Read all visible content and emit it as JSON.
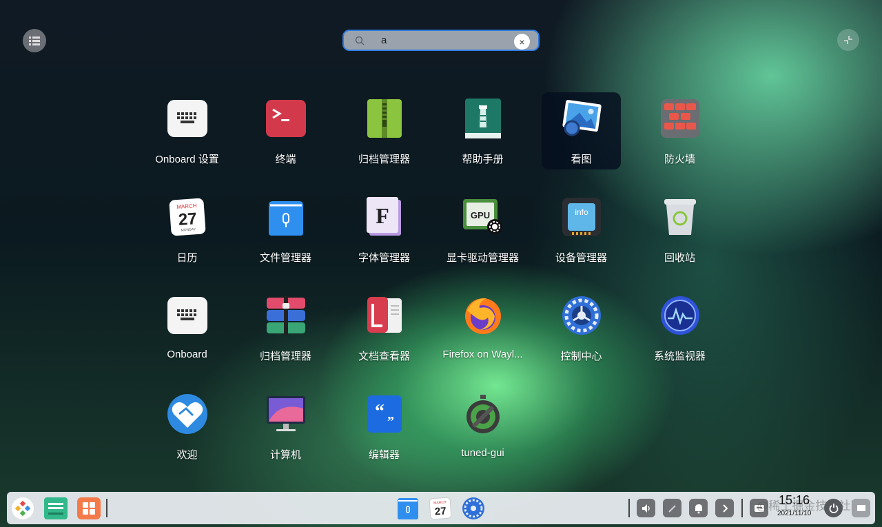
{
  "search": {
    "value": "a",
    "clear_symbol": "×",
    "icon": "search-icon"
  },
  "apps": [
    {
      "label": "Onboard 设置",
      "icon": "keyboard-icon"
    },
    {
      "label": "终端",
      "icon": "terminal-icon"
    },
    {
      "label": "归档管理器",
      "icon": "archive-zip-icon"
    },
    {
      "label": "帮助手册",
      "icon": "help-manual-icon"
    },
    {
      "label": "看图",
      "icon": "image-viewer-icon"
    },
    {
      "label": "防火墙",
      "icon": "firewall-icon"
    },
    {
      "label": "日历",
      "icon": "calendar-icon"
    },
    {
      "label": "文件管理器",
      "icon": "file-manager-icon"
    },
    {
      "label": "字体管理器",
      "icon": "font-manager-icon"
    },
    {
      "label": "显卡驱动管理器",
      "icon": "gpu-driver-icon"
    },
    {
      "label": "设备管理器",
      "icon": "device-manager-icon"
    },
    {
      "label": "回收站",
      "icon": "trash-icon"
    },
    {
      "label": "Onboard",
      "icon": "keyboard-icon"
    },
    {
      "label": "归档管理器",
      "icon": "archive-stack-icon"
    },
    {
      "label": "文档查看器",
      "icon": "document-viewer-icon"
    },
    {
      "label": "Firefox on Wayl...",
      "icon": "firefox-icon"
    },
    {
      "label": "控制中心",
      "icon": "control-center-icon"
    },
    {
      "label": "系统监视器",
      "icon": "system-monitor-icon"
    },
    {
      "label": "欢迎",
      "icon": "welcome-icon"
    },
    {
      "label": "计算机",
      "icon": "computer-icon"
    },
    {
      "label": "编辑器",
      "icon": "editor-icon"
    },
    {
      "label": "tuned-gui",
      "icon": "tuned-gui-icon"
    }
  ],
  "calendar_icon": {
    "month": "MARCH",
    "day": "27",
    "weekday": "MONDAY"
  },
  "gpu_icon_text": "GPU",
  "info_icon_text": "info",
  "font_icon_letter": "F",
  "taskbar": {
    "clock_time": "15:16",
    "clock_date": "2021/11/10",
    "watermark": "@稀土掘金技术社区"
  },
  "colors": {
    "search_border": "#2f7be0",
    "selected_tile": "#08111f"
  }
}
